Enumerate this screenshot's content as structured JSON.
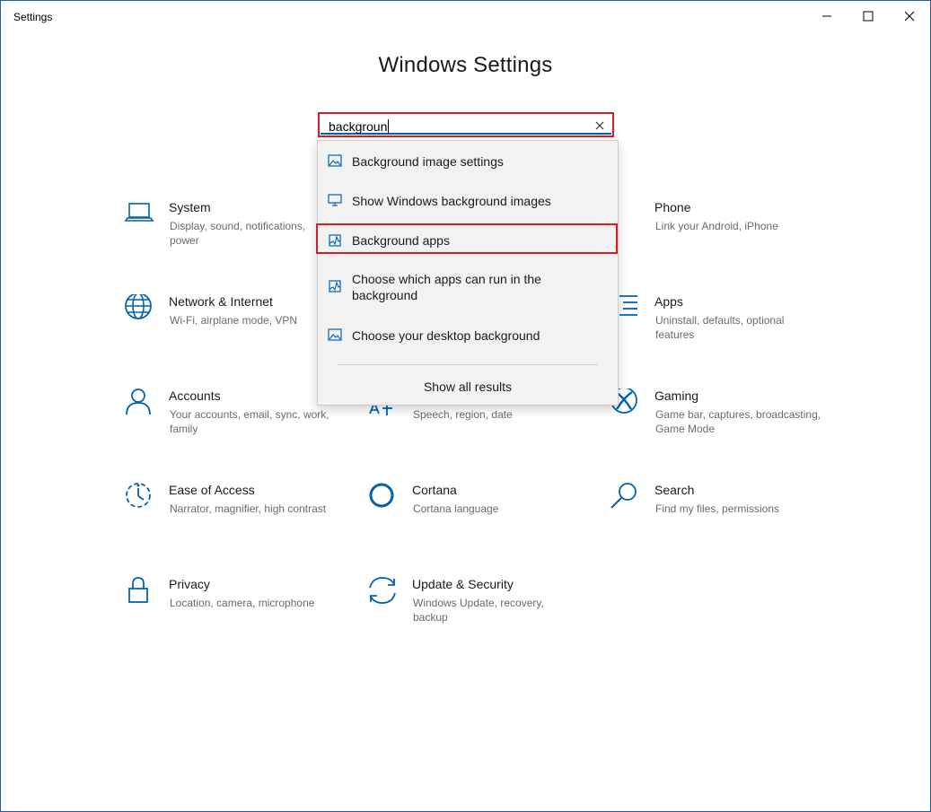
{
  "window": {
    "title": "Settings"
  },
  "page": {
    "title": "Windows Settings"
  },
  "search": {
    "value": "backgroun"
  },
  "dropdown": {
    "items": [
      {
        "label": "Background image settings",
        "icon": "image-icon"
      },
      {
        "label": "Show Windows background images",
        "icon": "monitor-icon"
      },
      {
        "label": "Background apps",
        "icon": "app-activity-icon"
      },
      {
        "label": "Choose which apps can run in the background",
        "icon": "app-activity-icon"
      },
      {
        "label": "Choose your desktop background",
        "icon": "image-icon"
      }
    ],
    "show_all": "Show all results"
  },
  "tiles": {
    "system": {
      "title": "System",
      "desc": "Display, sound, notifications, power"
    },
    "phone": {
      "title": "Phone",
      "desc": "Link your Android, iPhone"
    },
    "network": {
      "title": "Network & Internet",
      "desc": "Wi-Fi, airplane mode, VPN"
    },
    "apps": {
      "title": "Apps",
      "desc": "Uninstall, defaults, optional features"
    },
    "accounts": {
      "title": "Accounts",
      "desc": "Your accounts, email, sync, work, family"
    },
    "time_language": {
      "desc": "Speech, region, date"
    },
    "gaming": {
      "title": "Gaming",
      "desc": "Game bar, captures, broadcasting, Game Mode"
    },
    "ease": {
      "title": "Ease of Access",
      "desc": "Narrator, magnifier, high contrast"
    },
    "cortana": {
      "title": "Cortana",
      "desc": "Cortana language"
    },
    "search": {
      "title": "Search",
      "desc": "Find my files, permissions"
    },
    "privacy": {
      "title": "Privacy",
      "desc": "Location, camera, microphone"
    },
    "update": {
      "title": "Update & Security",
      "desc": "Windows Update, recovery, backup"
    }
  },
  "colors": {
    "accent": "#0063b1",
    "highlight": "#d41f2a"
  }
}
